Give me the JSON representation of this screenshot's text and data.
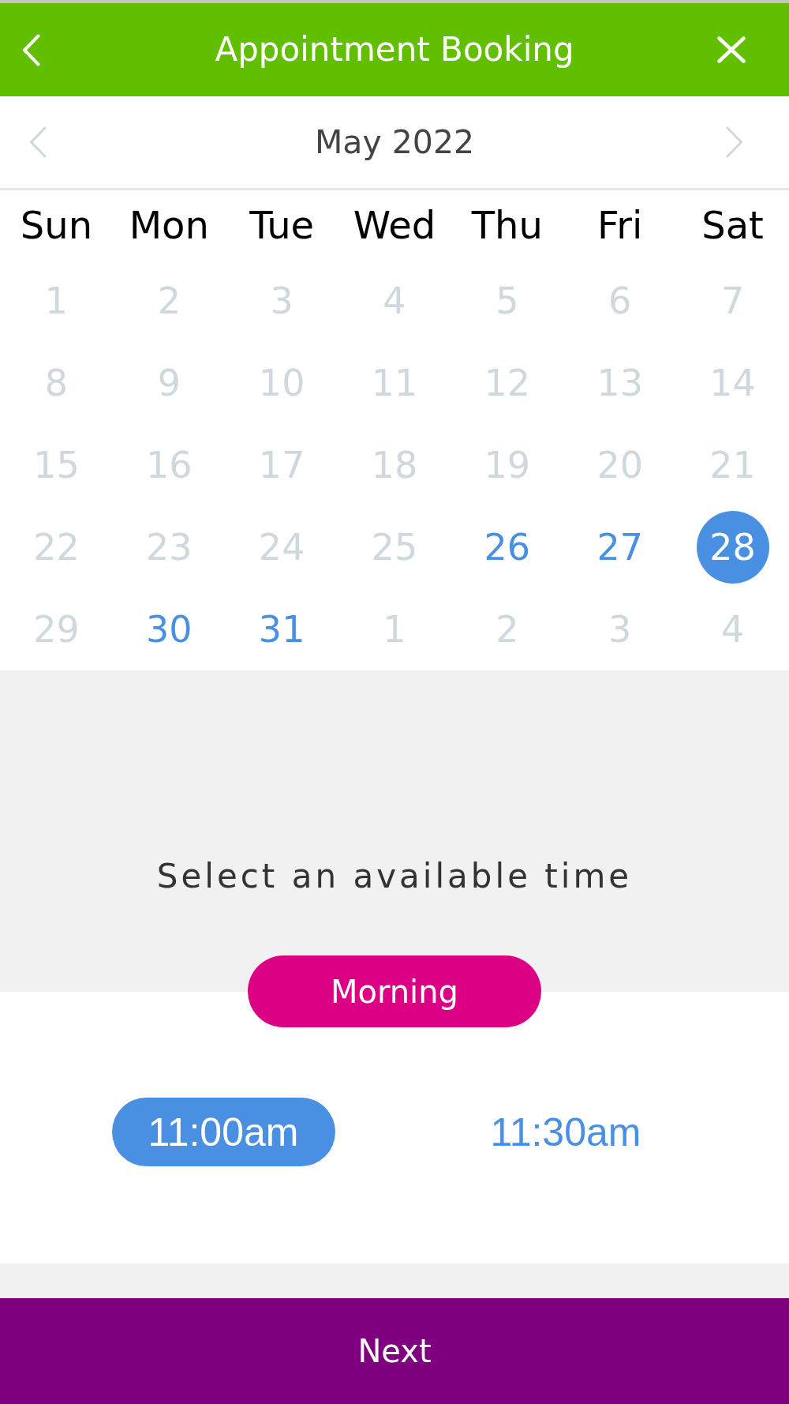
{
  "header": {
    "title": "Appointment Booking"
  },
  "calendar": {
    "month": "May 2022",
    "weekdays": [
      "Sun",
      "Mon",
      "Tue",
      "Wed",
      "Thu",
      "Fri",
      "Sat"
    ],
    "days": [
      {
        "label": "1",
        "available": false,
        "selected": false
      },
      {
        "label": "2",
        "available": false,
        "selected": false
      },
      {
        "label": "3",
        "available": false,
        "selected": false
      },
      {
        "label": "4",
        "available": false,
        "selected": false
      },
      {
        "label": "5",
        "available": false,
        "selected": false
      },
      {
        "label": "6",
        "available": false,
        "selected": false
      },
      {
        "label": "7",
        "available": false,
        "selected": false
      },
      {
        "label": "8",
        "available": false,
        "selected": false
      },
      {
        "label": "9",
        "available": false,
        "selected": false
      },
      {
        "label": "10",
        "available": false,
        "selected": false
      },
      {
        "label": "11",
        "available": false,
        "selected": false
      },
      {
        "label": "12",
        "available": false,
        "selected": false
      },
      {
        "label": "13",
        "available": false,
        "selected": false
      },
      {
        "label": "14",
        "available": false,
        "selected": false
      },
      {
        "label": "15",
        "available": false,
        "selected": false
      },
      {
        "label": "16",
        "available": false,
        "selected": false
      },
      {
        "label": "17",
        "available": false,
        "selected": false
      },
      {
        "label": "18",
        "available": false,
        "selected": false
      },
      {
        "label": "19",
        "available": false,
        "selected": false
      },
      {
        "label": "20",
        "available": false,
        "selected": false
      },
      {
        "label": "21",
        "available": false,
        "selected": false
      },
      {
        "label": "22",
        "available": false,
        "selected": false
      },
      {
        "label": "23",
        "available": false,
        "selected": false
      },
      {
        "label": "24",
        "available": false,
        "selected": false
      },
      {
        "label": "25",
        "available": false,
        "selected": false
      },
      {
        "label": "26",
        "available": true,
        "selected": false
      },
      {
        "label": "27",
        "available": true,
        "selected": false
      },
      {
        "label": "28",
        "available": true,
        "selected": true
      },
      {
        "label": "29",
        "available": false,
        "selected": false
      },
      {
        "label": "30",
        "available": true,
        "selected": false
      },
      {
        "label": "31",
        "available": true,
        "selected": false
      },
      {
        "label": "1",
        "available": false,
        "selected": false
      },
      {
        "label": "2",
        "available": false,
        "selected": false
      },
      {
        "label": "3",
        "available": false,
        "selected": false
      },
      {
        "label": "4",
        "available": false,
        "selected": false
      }
    ]
  },
  "time_picker": {
    "prompt": "Select an available time",
    "period": "Morning",
    "slots": [
      {
        "label": "11:00am",
        "selected": true
      },
      {
        "label": "11:30am",
        "selected": false
      }
    ]
  },
  "next_button": {
    "label": "Next"
  }
}
